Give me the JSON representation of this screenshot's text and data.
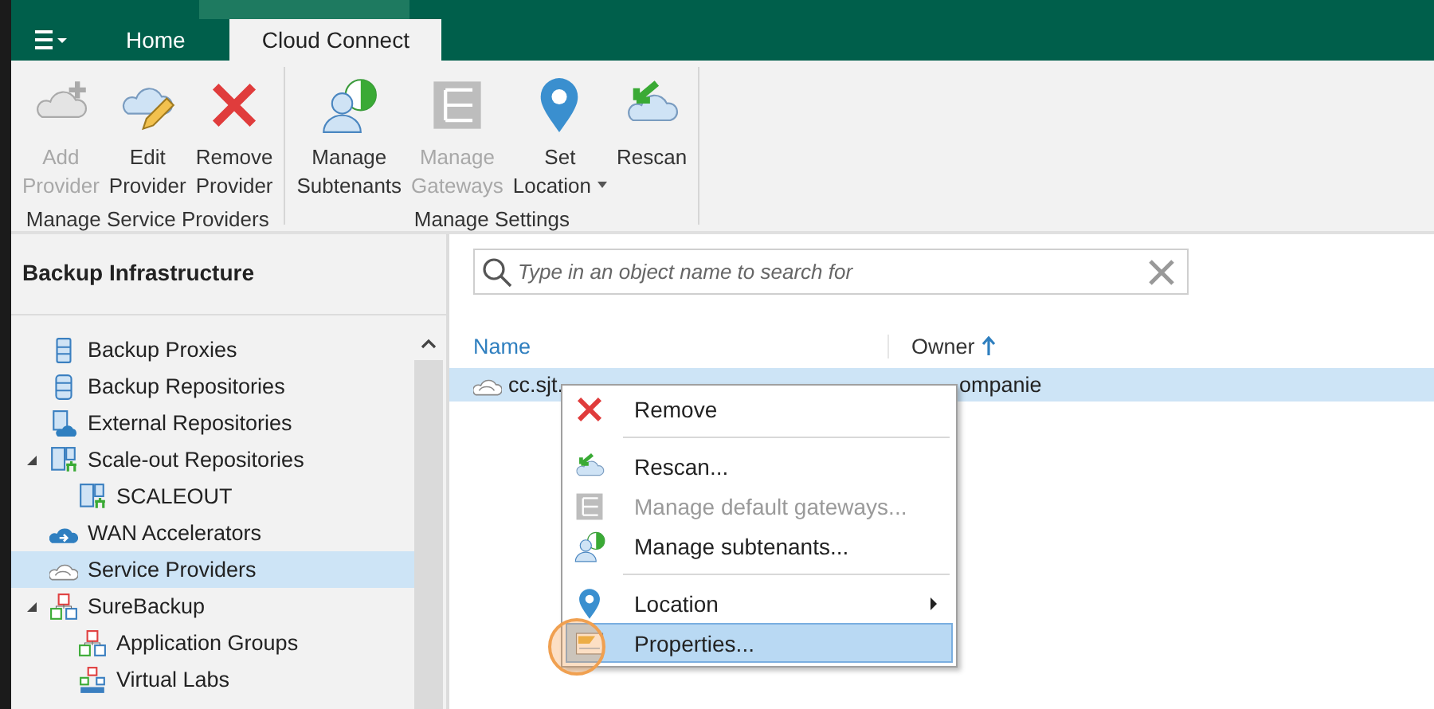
{
  "tabs": [
    {
      "label": "Home",
      "selected": false
    },
    {
      "label": "Cloud Connect",
      "selected": true
    }
  ],
  "ribbon": {
    "groups": [
      {
        "label": "Manage Service Providers",
        "buttons": [
          {
            "label": "Add\nProvider",
            "kind": "cloud-add",
            "disabled": true,
            "dropdown": false
          },
          {
            "label": "Edit\nProvider",
            "kind": "cloud-edit",
            "disabled": false,
            "dropdown": false
          },
          {
            "label": "Remove\nProvider",
            "kind": "remove",
            "disabled": false,
            "dropdown": false
          }
        ]
      },
      {
        "label": "Manage Settings",
        "buttons": [
          {
            "label": "Manage\nSubtenants",
            "kind": "subtenants",
            "disabled": false,
            "dropdown": false
          },
          {
            "label": "Manage\nGateways",
            "kind": "gateways",
            "disabled": true,
            "dropdown": false
          },
          {
            "label": "Set\nLocation",
            "kind": "location",
            "disabled": false,
            "dropdown": true
          },
          {
            "label": "Rescan",
            "kind": "rescan",
            "disabled": false,
            "dropdown": false
          }
        ]
      }
    ]
  },
  "sidebar": {
    "title": "Backup Infrastructure",
    "items": [
      {
        "label": "Backup Proxies",
        "kind": "proxy",
        "selected": false
      },
      {
        "label": "Backup Repositories",
        "kind": "repository",
        "selected": false
      },
      {
        "label": "External Repositories",
        "kind": "external",
        "selected": false
      },
      {
        "label": "Scale-out Repositories",
        "kind": "scaleout",
        "selected": false,
        "expanded": true,
        "children": [
          {
            "label": "SCALEOUT",
            "kind": "scaleout",
            "selected": false
          }
        ]
      },
      {
        "label": "WAN Accelerators",
        "kind": "wan",
        "selected": false
      },
      {
        "label": "Service Providers",
        "kind": "providers",
        "selected": true
      },
      {
        "label": "SureBackup",
        "kind": "surebackup",
        "selected": false,
        "expanded": true,
        "children": [
          {
            "label": "Application Groups",
            "kind": "surebackup",
            "selected": false
          },
          {
            "label": "Virtual Labs",
            "kind": "labs",
            "selected": false
          }
        ]
      }
    ]
  },
  "list": {
    "search": {
      "placeholder": "Type in an object name to search for"
    },
    "columns": [
      {
        "label": "Name",
        "sorted": false
      },
      {
        "label": "Owner",
        "sorted": true
      }
    ],
    "rows": [
      {
        "name": "cc.sjt.",
        "owner": "ompanie",
        "selected": true
      }
    ]
  },
  "context_menu": {
    "items": [
      {
        "kind": "item",
        "label": "Remove",
        "disabled": false,
        "submenu": false,
        "selected": false
      },
      {
        "kind": "separator"
      },
      {
        "kind": "item",
        "label": "Rescan...",
        "disabled": false,
        "submenu": false,
        "selected": false
      },
      {
        "kind": "item",
        "label": "Manage default gateways...",
        "disabled": true,
        "submenu": false,
        "selected": false
      },
      {
        "kind": "item",
        "label": "Manage subtenants...",
        "disabled": false,
        "submenu": false,
        "selected": false
      },
      {
        "kind": "separator"
      },
      {
        "kind": "item",
        "label": "Location",
        "disabled": false,
        "submenu": true,
        "selected": false
      },
      {
        "kind": "item",
        "label": "Properties...",
        "disabled": false,
        "submenu": false,
        "selected": true
      }
    ]
  }
}
